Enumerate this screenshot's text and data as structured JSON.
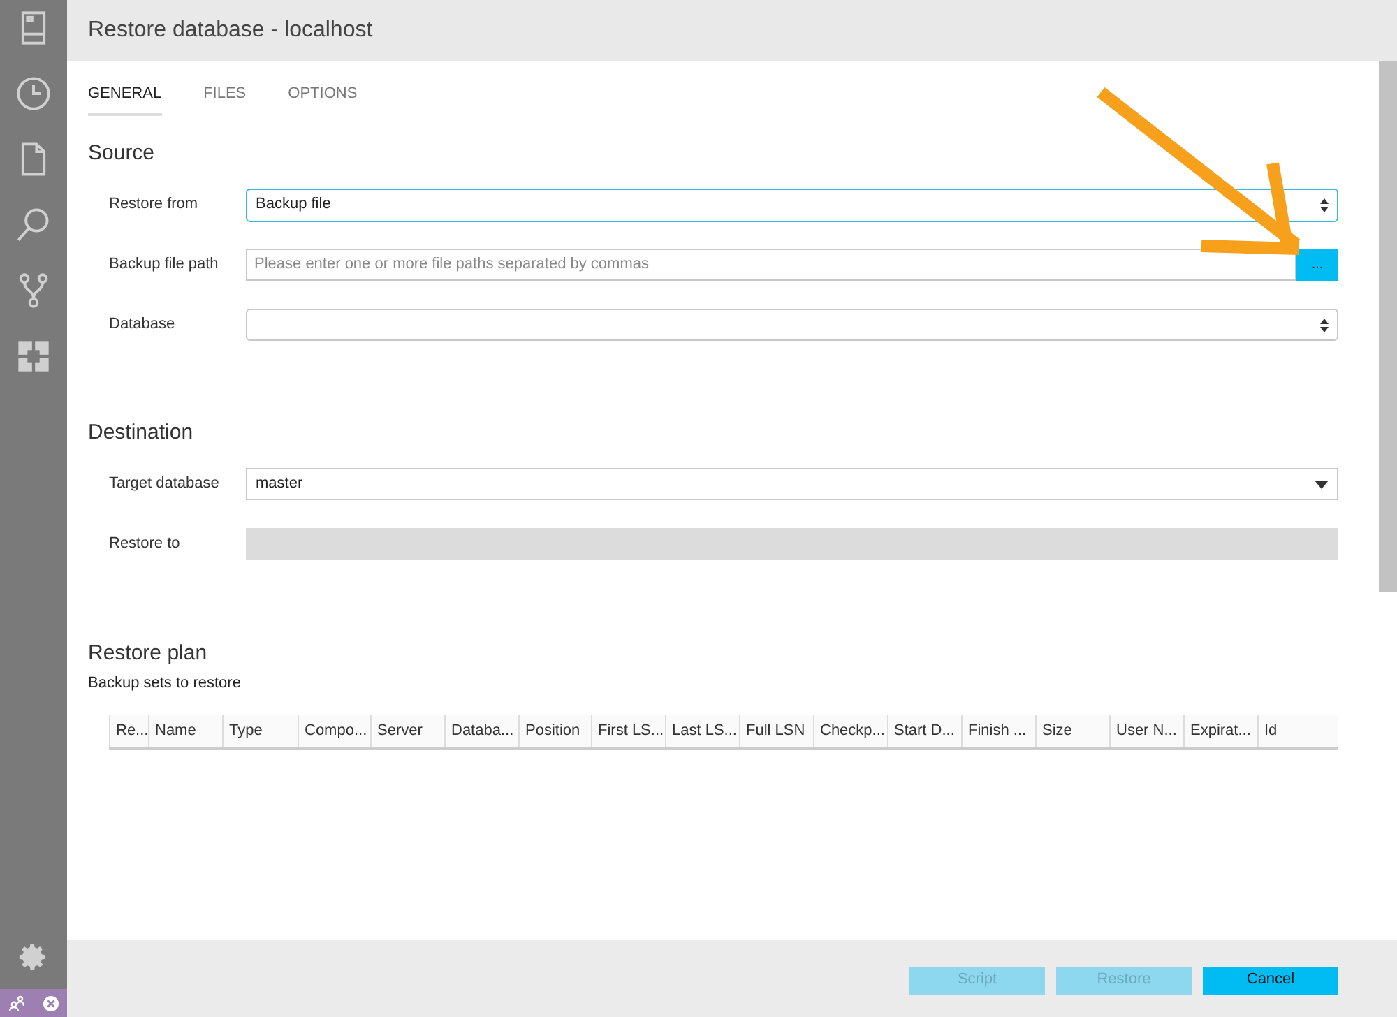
{
  "sidebar": {
    "items": [
      {
        "kind": "server",
        "selected": false
      },
      {
        "kind": "history",
        "selected": false
      },
      {
        "kind": "file",
        "selected": false
      },
      {
        "kind": "search",
        "selected": false
      },
      {
        "kind": "branch",
        "selected": false
      },
      {
        "kind": "extensions",
        "selected": false
      }
    ]
  },
  "window": {
    "title": "Restore database - localhost"
  },
  "tabs": [
    {
      "label": "GENERAL",
      "selected": true
    },
    {
      "label": "FILES",
      "selected": false
    },
    {
      "label": "OPTIONS",
      "selected": false
    }
  ],
  "sections": [
    {
      "title": "Source",
      "fields": [
        {
          "kind": "select",
          "label": "Restore from",
          "value": "Backup file",
          "focused": true
        },
        {
          "kind": "text",
          "label": "Backup file path",
          "placeholder": "Please enter one or more file paths separated by commas",
          "button": "..."
        },
        {
          "kind": "select",
          "label": "Database",
          "focused": false
        }
      ]
    },
    {
      "title": "Destination",
      "fields": [
        {
          "kind": "dropdown",
          "label": "Target database",
          "value": "master"
        },
        {
          "kind": "readonly",
          "label": "Restore to"
        }
      ]
    }
  ],
  "restore_plan": {
    "title": "Restore plan",
    "subtitle": "Backup sets to restore",
    "columns": [
      "Re...",
      "Name",
      "Type",
      "Compo...",
      "Server",
      "Databa...",
      "Position",
      "First LS...",
      "Last LS...",
      "Full LSN",
      "Checkp...",
      "Start D...",
      "Finish ...",
      "Size",
      "User N...",
      "Expirat...",
      "Id"
    ]
  },
  "buttons": [
    {
      "label": "Script",
      "disabled": true
    },
    {
      "label": "Restore",
      "disabled": true
    },
    {
      "label": "Cancel",
      "disabled": false
    }
  ]
}
